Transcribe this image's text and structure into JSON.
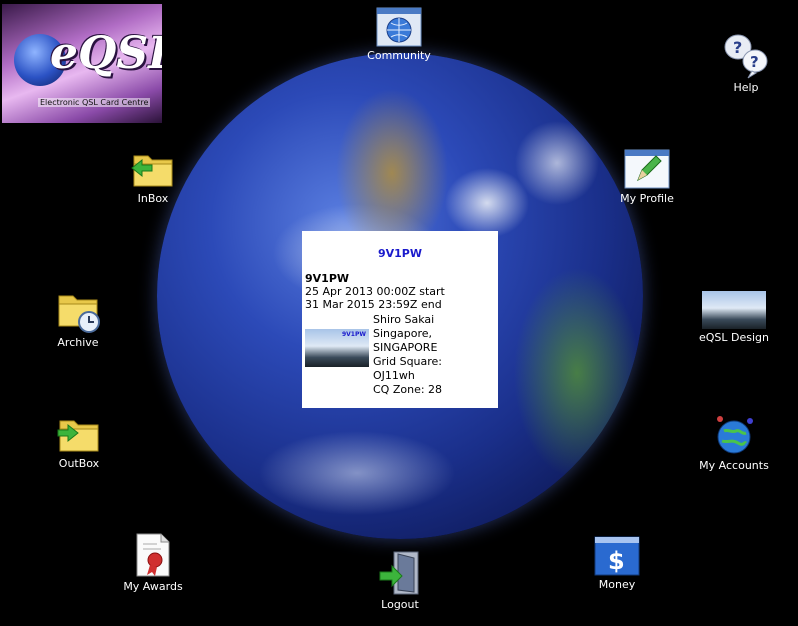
{
  "logo": {
    "text": "eQSL",
    "subtitle": "Electronic QSL Card Centre"
  },
  "nav": {
    "community": "Community",
    "help": "Help",
    "inbox": "InBox",
    "my_profile": "My Profile",
    "archive": "Archive",
    "eqsl_design": "eQSL Design",
    "outbox": "OutBox",
    "my_accounts": "My Accounts",
    "my_awards": "My Awards",
    "logout": "Logout",
    "money": "Money"
  },
  "popup": {
    "title": "9V1PW",
    "callsign": "9V1PW",
    "start": "25 Apr 2013 00:00Z start",
    "end": "31 Mar 2015 23:59Z end",
    "thumb_label": "9V1PW",
    "name": "Shiro Sakai",
    "city": "Singapore,",
    "country": "SINGAPORE",
    "grid_label": "Grid Square:",
    "grid": "OJ11wh",
    "cq_zone": "CQ Zone: 28"
  }
}
